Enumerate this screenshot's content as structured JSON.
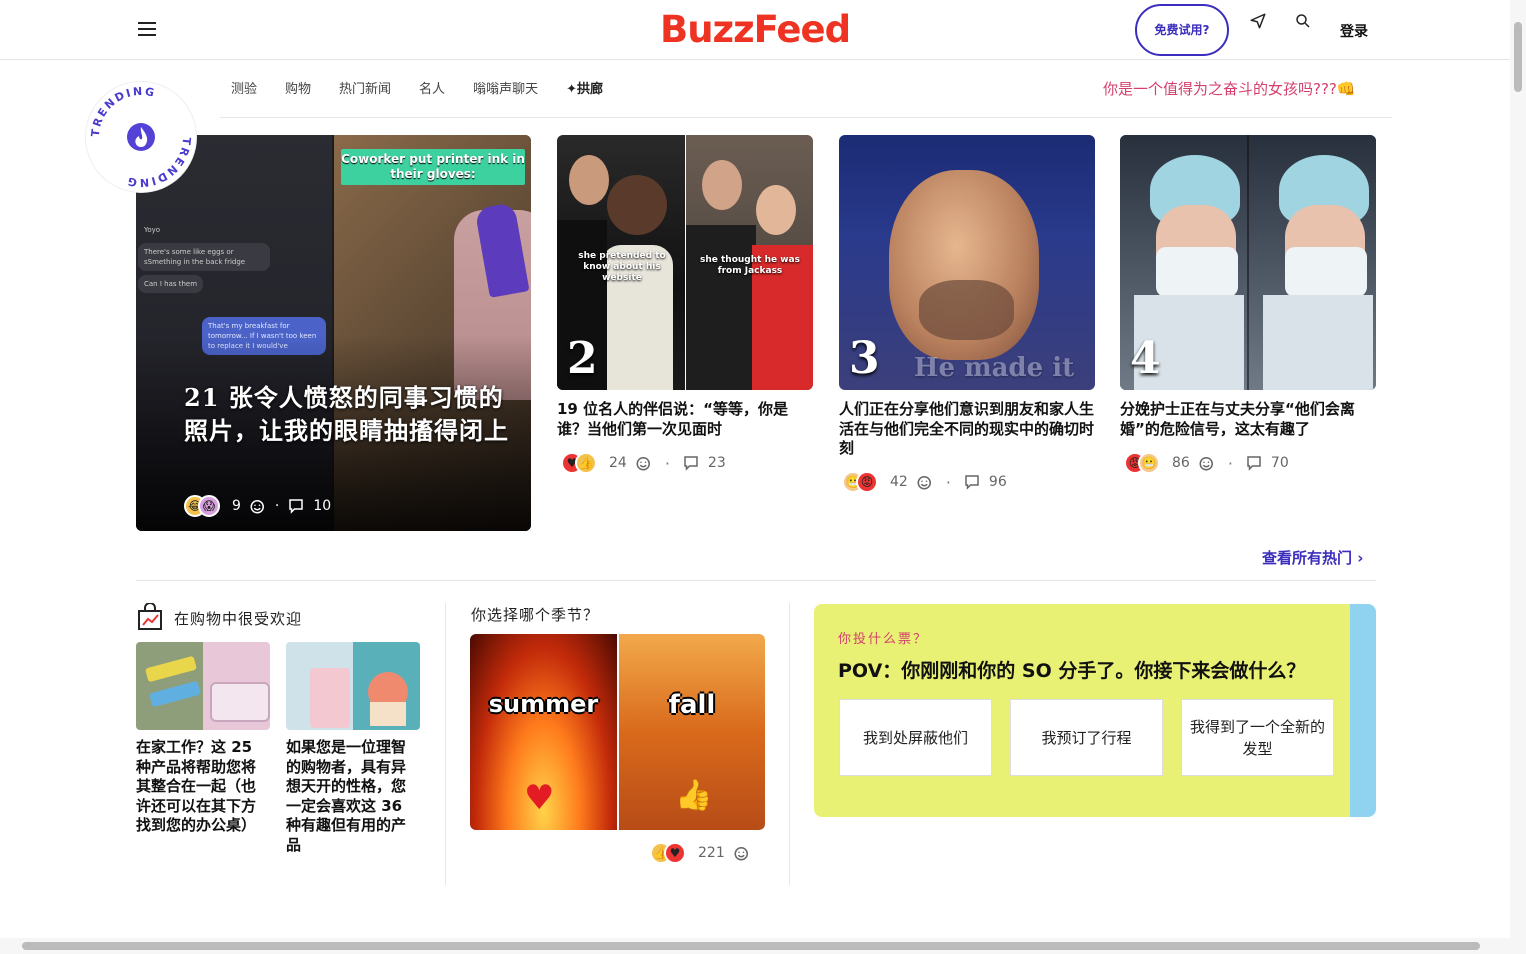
{
  "header": {
    "logo": "BuzzFeed",
    "trial_button": "免费试用?",
    "login": "登录"
  },
  "nav": {
    "items": [
      "测验",
      "购物",
      "热门新闻",
      "名人",
      "嗡嗡声聊天"
    ],
    "ai_item": "拱廊",
    "promo": "你是一个值得为之奋斗的女孩吗???👊"
  },
  "trending": {
    "badge_text": "TRENDING",
    "feature": {
      "overlay_label": "Coworker put printer ink in their gloves:",
      "chat_lines": [
        "Yoyo",
        "There's some like eggs or sSmething in the back fridge",
        "Can I has them",
        "That's my breakfast for tomorrow... If I wasn't too keen to replace it I would've"
      ],
      "title": "21 张令人愤怒的同事习惯的照片，让我的眼睛抽搐得闭上",
      "reactions": "9",
      "comments": "10"
    },
    "cards": [
      {
        "number": "2",
        "caption_left": "she pretended to know about his website",
        "caption_right": "she thought he was from Jackass",
        "title": "19 位名人的伴侣说：“等等，你是谁？当他们第一次见面时",
        "reactions": "24",
        "comments": "23"
      },
      {
        "number": "3",
        "caption": "He made it up",
        "title": "人们正在分享他们意识到朋友和家人生活在与他们完全不同的现实中的确切时刻",
        "reactions": "42",
        "comments": "96"
      },
      {
        "number": "4",
        "title": "分娩护士正在与丈夫分享“他们会离婚”的危险信号，这太有趣了",
        "reactions": "86",
        "comments": "70"
      }
    ],
    "view_all": "查看所有热门"
  },
  "shopping": {
    "heading": "在购物中很受欢迎",
    "items": [
      {
        "title": "在家工作？这 25 种产品将帮助您将其整合在一起（也许还可以在其下方找到您的办公桌）"
      },
      {
        "title": "如果您是一位理智的购物者，具有异想天开的性格，您一定会喜欢这 36 种有趣但有用的产品"
      }
    ]
  },
  "season_quiz": {
    "heading": "你选择哪个季节？",
    "left_label": "summer",
    "right_label": "fall",
    "reactions": "221"
  },
  "poll": {
    "question_label": "你投什么票？",
    "title": "POV：你刚刚和你的 SO 分手了。你接下来会做什么？",
    "options": [
      "我到处屏蔽他们",
      "我预订了行程",
      "我得到了一个全新的发型"
    ]
  },
  "colors": {
    "brand_red": "#ee3322",
    "accent_purple": "#3b2dbd",
    "promo_pink": "#d4406e",
    "poll_yellow": "#e8f173"
  }
}
